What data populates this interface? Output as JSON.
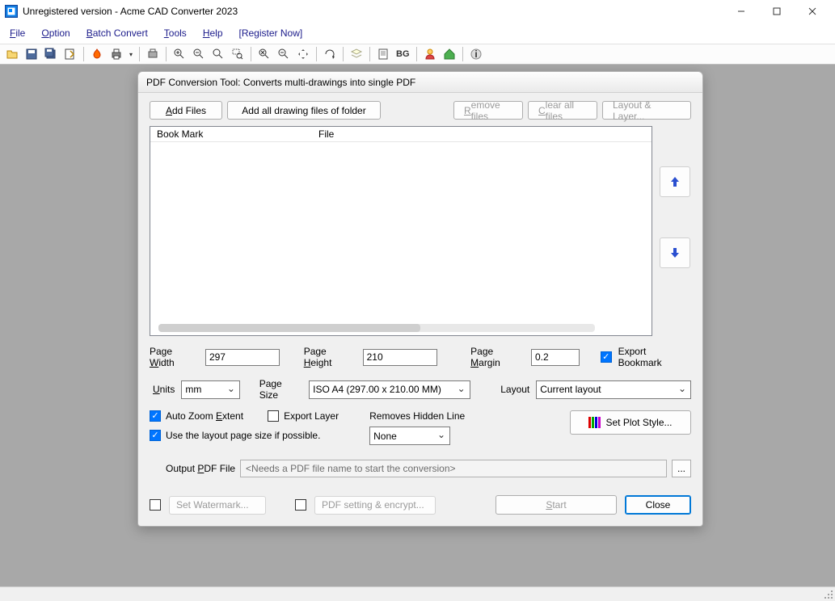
{
  "window": {
    "title": "Unregistered version - Acme CAD Converter 2023",
    "app_icon_text": "⧉"
  },
  "menu": {
    "file": "File",
    "option": "Option",
    "batch": "Batch Convert",
    "tools": "Tools",
    "help": "Help",
    "register": "[Register Now]"
  },
  "dialog": {
    "title": "PDF Conversion Tool: Converts multi-drawings into single PDF",
    "add_files": "Add Files",
    "add_folder": "Add all drawing files of folder",
    "remove": "Remove files",
    "clear": "Clear all files",
    "layout_layer": "Layout & Layer...",
    "col_bookmark": "Book Mark",
    "col_file": "File",
    "page_width_label": "Page Width",
    "page_width_value": "297",
    "page_height_label": "Page Height",
    "page_height_value": "210",
    "page_margin_label": "Page Margin",
    "page_margin_value": "0.2",
    "export_bookmark": "Export Bookmark",
    "units_label": "Units",
    "units_value": "mm",
    "page_size_label": "Page Size",
    "page_size_value": "ISO A4 (297.00 x 210.00 MM)",
    "layout_label": "Layout",
    "layout_value": "Current layout",
    "auto_zoom": "Auto Zoom Extent",
    "export_layer": "Export Layer",
    "removes_hidden": "Removes Hidden Line",
    "hidden_value": "None",
    "use_layout": "Use the layout page size if possible.",
    "set_plot": "Set Plot Style...",
    "output_label": "Output PDF File",
    "output_placeholder": "<Needs a PDF file name to start the conversion>",
    "browse": "...",
    "watermark": "Set Watermark...",
    "pdf_setting": "PDF setting & encrypt...",
    "start": "Start",
    "close": "Close"
  }
}
